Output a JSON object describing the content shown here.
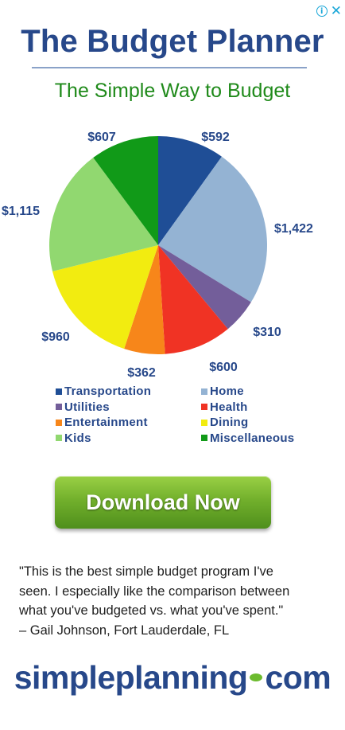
{
  "ad": {
    "info_icon": "ⓘ",
    "close_icon": "✕",
    "title": "The Budget Planner",
    "subtitle": "The Simple Way to Budget",
    "cta_label": "Download Now",
    "quote_lines": [
      "\"This is the best simple budget program I've",
      "seen. I especially like the comparison between",
      "what you've budgeted vs. what you've spent.\"",
      "– Gail Johnson, Fort Lauderdale, FL"
    ],
    "logo_left": "simpleplanning",
    "logo_right": "com"
  },
  "colors": {
    "title": "#27488a",
    "subtitle": "#1f8a1a",
    "label": "#27488a",
    "button": "#72b02c",
    "logo_dot": "#6cbb2e"
  },
  "chart_data": {
    "type": "pie",
    "title": "",
    "slices": [
      {
        "name": "Transportation",
        "value": 592,
        "label": "$592",
        "color": "#1f4e96"
      },
      {
        "name": "Home",
        "value": 1422,
        "label": "$1,422",
        "color": "#94b3d3"
      },
      {
        "name": "Utilities",
        "value": 310,
        "label": "$310",
        "color": "#735e9a"
      },
      {
        "name": "Health",
        "value": 600,
        "label": "$600",
        "color": "#f03324"
      },
      {
        "name": "Entertainment",
        "value": 362,
        "label": "$362",
        "color": "#f7861a"
      },
      {
        "name": "Dining",
        "value": 960,
        "label": "$960",
        "color": "#f2ec10"
      },
      {
        "name": "Kids",
        "value": 1115,
        "label": "$1,115",
        "color": "#91d870"
      },
      {
        "name": "Miscellaneous",
        "value": 607,
        "label": "$607",
        "color": "#119a18"
      }
    ],
    "legend": {
      "placement": "bottom",
      "order": [
        "Transportation",
        "Home",
        "Utilities",
        "Health",
        "Entertainment",
        "Dining",
        "Kids",
        "Miscellaneous"
      ]
    }
  }
}
